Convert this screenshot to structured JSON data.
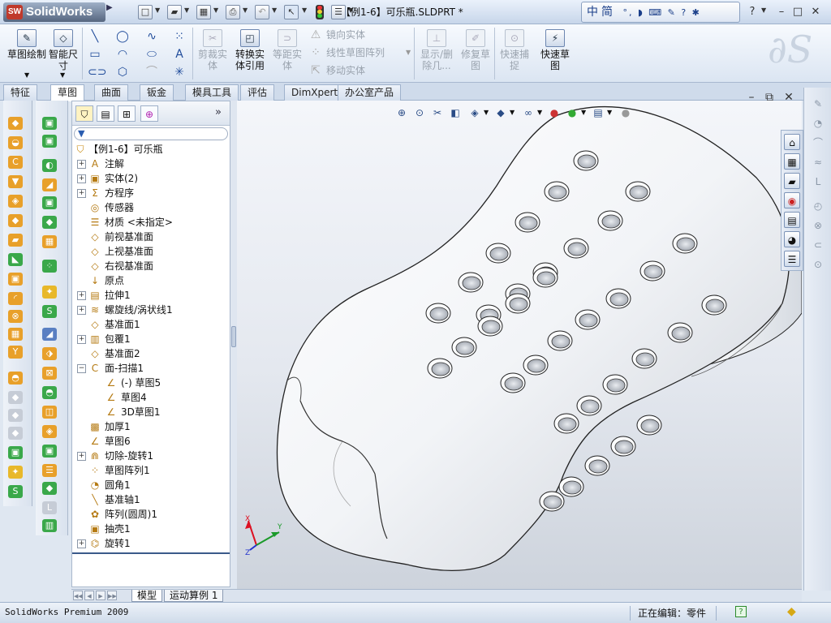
{
  "app": {
    "name": "SolidWorks",
    "logo_mark": "SW",
    "edition": "SolidWorks Premium 2009"
  },
  "titlebar": {
    "document_title": "【例1-6】可乐瓶.SLDPRT *",
    "ime_text": "中简",
    "help": "?"
  },
  "commands": {
    "sketch": "草图绘制",
    "smart_dimension": "智能尺寸",
    "trim": "剪裁实体",
    "convert": "转换实体引用",
    "offset": "等距实体",
    "mirror": "镜向实体",
    "linear_pattern": "线性草图阵列",
    "move": "移动实体",
    "show_delete": "显示/删除几...",
    "repair": "修复草图",
    "quick_snap": "快速捕捉",
    "rapid_sketch": "快速草图"
  },
  "tabs": [
    "特征",
    "草图",
    "曲面",
    "钣金",
    "模具工具",
    "评估",
    "DimXpert",
    "办公室产品"
  ],
  "active_tab": 1,
  "tree": {
    "root": "【例1-6】可乐瓶",
    "items": [
      {
        "label": "注解",
        "icon": "A",
        "exp": "+",
        "indent": 0
      },
      {
        "label": "实体(2)",
        "icon": "▣",
        "exp": "+",
        "indent": 0
      },
      {
        "label": "方程序",
        "icon": "Σ",
        "exp": "+",
        "indent": 0
      },
      {
        "label": "传感器",
        "icon": "◎",
        "exp": "",
        "indent": 0
      },
      {
        "label": "材质 <未指定>",
        "icon": "☰",
        "exp": "",
        "indent": 0
      },
      {
        "label": "前视基准面",
        "icon": "◇",
        "exp": "",
        "indent": 0
      },
      {
        "label": "上视基准面",
        "icon": "◇",
        "exp": "",
        "indent": 0
      },
      {
        "label": "右视基准面",
        "icon": "◇",
        "exp": "",
        "indent": 0
      },
      {
        "label": "原点",
        "icon": "↓",
        "exp": "",
        "indent": 0
      },
      {
        "label": "拉伸1",
        "icon": "▤",
        "exp": "+",
        "indent": 0
      },
      {
        "label": "螺旋线/涡状线1",
        "icon": "≋",
        "exp": "+",
        "indent": 0
      },
      {
        "label": "基准面1",
        "icon": "◇",
        "exp": "",
        "indent": 0
      },
      {
        "label": "包覆1",
        "icon": "▥",
        "exp": "+",
        "indent": 0
      },
      {
        "label": "基准面2",
        "icon": "◇",
        "exp": "",
        "indent": 0
      },
      {
        "label": "面-扫描1",
        "icon": "C",
        "exp": "−",
        "indent": 0
      },
      {
        "label": "(-) 草图5",
        "icon": "∠",
        "exp": "",
        "indent": 1
      },
      {
        "label": "草图4",
        "icon": "∠",
        "exp": "",
        "indent": 1
      },
      {
        "label": "3D草图1",
        "icon": "∠",
        "exp": "",
        "indent": 1
      },
      {
        "label": "加厚1",
        "icon": "▩",
        "exp": "",
        "indent": 0
      },
      {
        "label": "草图6",
        "icon": "∠",
        "exp": "",
        "indent": 0
      },
      {
        "label": "切除-旋转1",
        "icon": "⋒",
        "exp": "+",
        "indent": 0
      },
      {
        "label": "草图阵列1",
        "icon": "⁘",
        "exp": "",
        "indent": 0
      },
      {
        "label": "圆角1",
        "icon": "◔",
        "exp": "",
        "indent": 0
      },
      {
        "label": "基准轴1",
        "icon": "╲",
        "exp": "",
        "indent": 0
      },
      {
        "label": "阵列(圆周)1",
        "icon": "✿",
        "exp": "",
        "indent": 0
      },
      {
        "label": "抽壳1",
        "icon": "▣",
        "exp": "",
        "indent": 0
      },
      {
        "label": "旋转1",
        "icon": "⌬",
        "exp": "+",
        "indent": 0
      }
    ]
  },
  "bottom_tabs": [
    "模型",
    "运动算例 1"
  ],
  "status": {
    "editing": "正在编辑：零件"
  },
  "triad": {
    "x": "X",
    "y": "Y",
    "z": "Z"
  },
  "colors": {
    "accent": "#1f4b9a",
    "titlebar": "#c7d6ea",
    "model": "#ffffff"
  }
}
